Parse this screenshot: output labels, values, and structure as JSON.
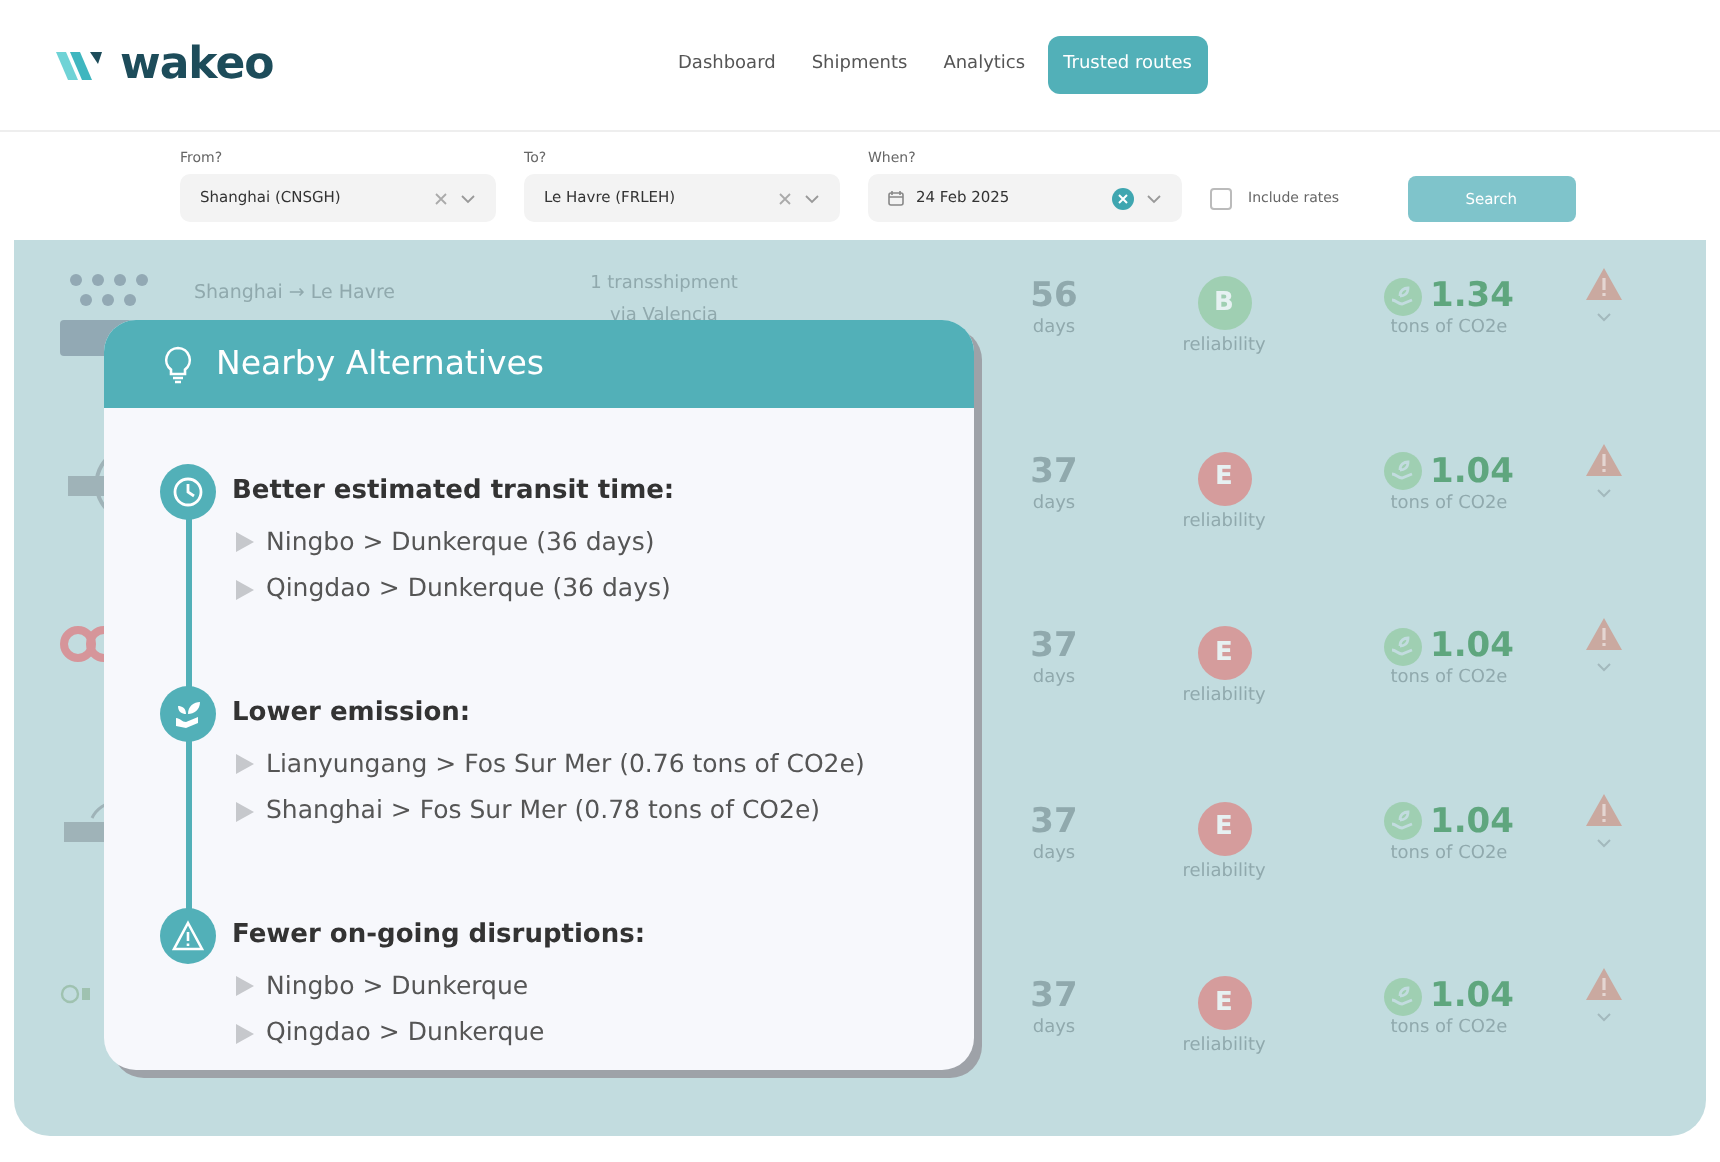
{
  "brand": {
    "name": "wakeo"
  },
  "nav": [
    {
      "label": "Dashboard",
      "selected": false
    },
    {
      "label": "Shipments",
      "selected": false
    },
    {
      "label": "Analytics",
      "selected": false
    },
    {
      "label": "Trusted routes",
      "selected": true
    }
  ],
  "filters": {
    "from": {
      "label": "From?",
      "value": "Shanghai (CNSGH)"
    },
    "to": {
      "label": "To?",
      "value": "Le Havre (FRLEH)"
    },
    "when": {
      "label": "When?",
      "value": "24 Feb 2025"
    },
    "include_rates": {
      "label": "Include rates",
      "checked": false
    },
    "search_button": "Search"
  },
  "routes": [
    {
      "kind": "stars",
      "route": "Shanghai → Le Havre",
      "transshipment": [
        "1 transshipment",
        "via Valencia"
      ],
      "days": "56",
      "days_unit": "days",
      "grade": "B",
      "color": "#9fcfb2",
      "grade_label": "reliability",
      "emission": "1.34",
      "emission_unit": "tons of CO2e",
      "warning": true
    },
    {
      "kind": "arc",
      "days": "37",
      "days_unit": "days",
      "grade": "E",
      "color": "#d59c9c",
      "grade_label": "reliability",
      "emission": "1.04",
      "emission_unit": "tons of CO2e",
      "warning": true
    },
    {
      "kind": "rings",
      "days": "37",
      "days_unit": "days",
      "grade": "E",
      "color": "#d59c9c",
      "grade_label": "reliability",
      "emission": "1.04",
      "emission_unit": "tons of CO2e",
      "warning": true
    },
    {
      "kind": "arc2",
      "days": "37",
      "days_unit": "days",
      "grade": "E",
      "color": "#d59c9c",
      "grade_label": "reliability",
      "emission": "1.04",
      "emission_unit": "tons of CO2e",
      "warning": true
    },
    {
      "kind": "dot",
      "days": "37",
      "days_unit": "days",
      "grade": "E",
      "color": "#d59c9c",
      "grade_label": "reliability",
      "emission": "1.04",
      "emission_unit": "tons of CO2e",
      "warning": true
    }
  ],
  "popup": {
    "title": "Nearby Alternatives",
    "sections": [
      {
        "kind": "clock",
        "heading": "Better estimated transit time:",
        "items": [
          "Ningbo > Dunkerque (36 days)",
          "Qingdao > Dunkerque (36 days)"
        ]
      },
      {
        "kind": "leaf",
        "heading": "Lower emission:",
        "items": [
          "Lianyungang > Fos Sur Mer (0.76 tons of CO2e)",
          "Shanghai > Fos Sur Mer (0.78 tons of CO2e)"
        ]
      },
      {
        "kind": "warning",
        "heading": "Fewer on-going disruptions:",
        "items": [
          "Ningbo > Dunkerque",
          "Qingdao > Dunkerque"
        ]
      }
    ]
  }
}
